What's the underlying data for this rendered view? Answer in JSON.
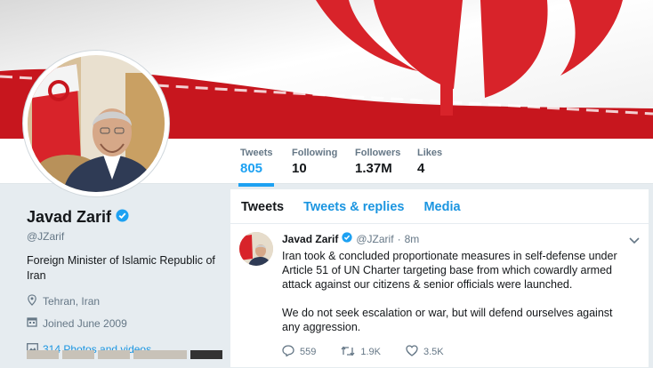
{
  "profile": {
    "name": "Javad Zarif",
    "handle": "@JZarif",
    "bio": "Foreign Minister of Islamic Republic of Iran",
    "location": "Tehran, Iran",
    "joined": "Joined June 2009",
    "photos": "314 Photos and videos"
  },
  "stats": [
    {
      "label": "Tweets",
      "value": "805"
    },
    {
      "label": "Following",
      "value": "10"
    },
    {
      "label": "Followers",
      "value": "1.37M"
    },
    {
      "label": "Likes",
      "value": "4"
    }
  ],
  "tabs": [
    "Tweets",
    "Tweets & replies",
    "Media"
  ],
  "tweet": {
    "name": "Javad Zarif",
    "handle": "@JZarif",
    "separator": "·",
    "time": "8m",
    "paragraph1": "Iran took & concluded proportionate measures in self-defense under Article 51 of UN Charter targeting base from which cowardly armed attack against our citizens & senior officials were launched.",
    "paragraph2": "We do not seek escalation or war, but will defend ourselves against any aggression.",
    "replies": "559",
    "retweets": "1.9K",
    "likes": "3.5K"
  },
  "colors": {
    "accent": "#1da1f2",
    "flag_red": "#d8232a",
    "background": "#e6ecf0"
  },
  "icons": [
    "verified-icon",
    "location-icon",
    "calendar-icon",
    "photo-icon",
    "chevron-down-icon",
    "reply-icon",
    "retweet-icon",
    "like-icon"
  ]
}
